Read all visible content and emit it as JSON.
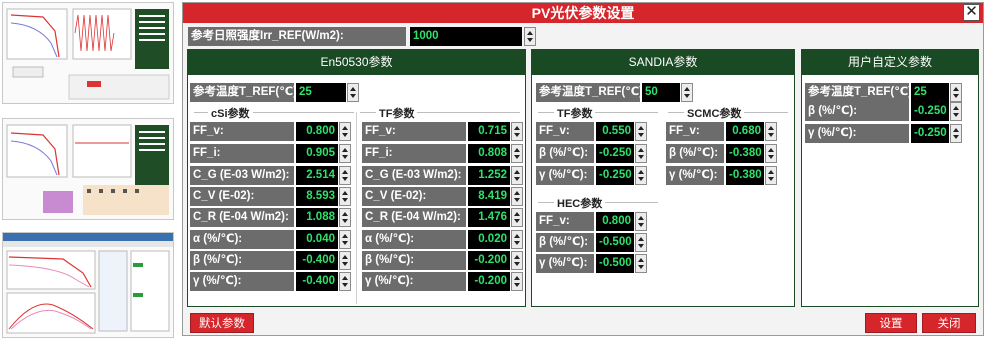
{
  "dialog": {
    "title": "PV光伏参数设置",
    "close_label": "✕"
  },
  "irr": {
    "label": "参考日照强度Irr_REF(W/m2):",
    "value": "1000"
  },
  "en50530": {
    "title": "En50530参数",
    "tref_label": "参考温度T_REF(℃):",
    "tref_value": "25",
    "csi": {
      "title": "cSi参数",
      "rows": [
        {
          "label": "FF_v:",
          "value": "0.800"
        },
        {
          "label": "FF_i:",
          "value": "0.905"
        },
        {
          "label": "C_G (E-03 W/m2):",
          "value": "2.514"
        },
        {
          "label": "C_V (E-02):",
          "value": "8.593"
        },
        {
          "label": "C_R (E-04 W/m2):",
          "value": "1.088"
        },
        {
          "label": "α (%/℃):",
          "value": "0.040"
        },
        {
          "label": "β (%/℃):",
          "value": "-0.400"
        },
        {
          "label": "γ (%/℃):",
          "value": "-0.400"
        }
      ]
    },
    "tf": {
      "title": "TF参数",
      "rows": [
        {
          "label": "FF_v:",
          "value": "0.715"
        },
        {
          "label": "FF_i:",
          "value": "0.808"
        },
        {
          "label": "C_G (E-03 W/m2):",
          "value": "1.252"
        },
        {
          "label": "C_V (E-02):",
          "value": "8.419"
        },
        {
          "label": "C_R (E-04 W/m2):",
          "value": "1.476"
        },
        {
          "label": "α (%/℃):",
          "value": "0.020"
        },
        {
          "label": "β (%/℃):",
          "value": "-0.200"
        },
        {
          "label": "γ (%/℃):",
          "value": "-0.200"
        }
      ]
    }
  },
  "sandia": {
    "title": "SANDIA参数",
    "tref_label": "参考温度T_REF(℃):",
    "tref_value": "50",
    "tf": {
      "title": "TF参数",
      "rows": [
        {
          "label": "FF_v:",
          "value": "0.550"
        },
        {
          "label": "β (%/℃):",
          "value": "-0.250"
        },
        {
          "label": "γ (%/℃):",
          "value": "-0.250"
        }
      ]
    },
    "scmc": {
      "title": "SCMC参数",
      "rows": [
        {
          "label": "FF_v:",
          "value": "0.680"
        },
        {
          "label": "β (%/℃):",
          "value": "-0.380"
        },
        {
          "label": "γ (%/℃):",
          "value": "-0.380"
        }
      ]
    },
    "hec": {
      "title": "HEC参数",
      "rows": [
        {
          "label": "FF_v:",
          "value": "0.800"
        },
        {
          "label": "β (%/℃):",
          "value": "-0.500"
        },
        {
          "label": "γ (%/℃):",
          "value": "-0.500"
        }
      ]
    }
  },
  "user": {
    "title": "用户自定义参数",
    "tref_label": "参考温度T_REF(℃):",
    "tref_value": "25",
    "rows": [
      {
        "label": "β (%/℃):",
        "value": "-0.250"
      },
      {
        "label": "γ (%/℃):",
        "value": "-0.250"
      }
    ]
  },
  "buttons": {
    "default": "默认参数",
    "set": "设置",
    "close": "关闭"
  },
  "colors": {
    "title_red": "#d5262b",
    "panel_green": "#1a4a24",
    "value_green": "#2fe06b",
    "label_gray": "#6c6c6c"
  }
}
